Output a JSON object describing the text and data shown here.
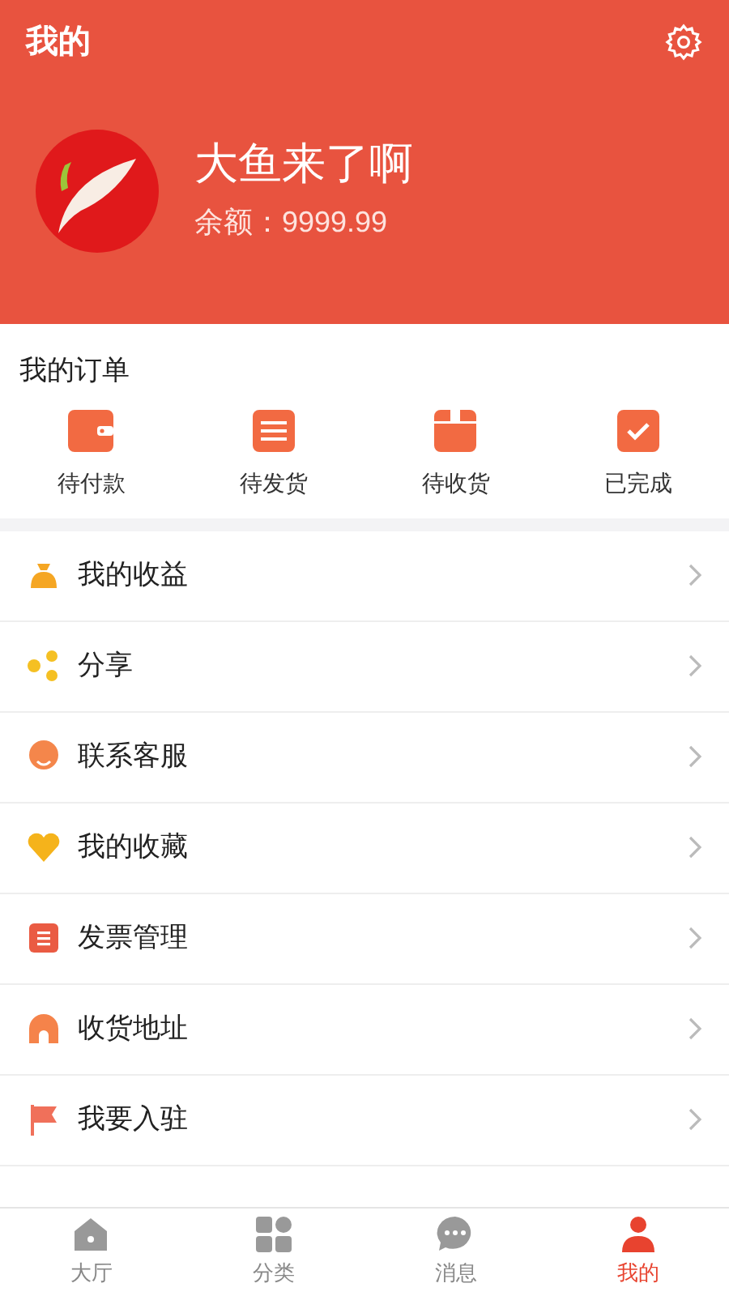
{
  "header": {
    "title": "我的",
    "username": "大鱼来了啊",
    "balance": "余额：9999.99"
  },
  "orders": {
    "title": "我的订单",
    "items": [
      {
        "kind": "wallet",
        "label": "待付款"
      },
      {
        "kind": "list",
        "label": "待发货"
      },
      {
        "kind": "box",
        "label": "待收货"
      },
      {
        "kind": "done",
        "label": "已完成"
      }
    ]
  },
  "menu": [
    {
      "kind": "money",
      "label": "我的收益"
    },
    {
      "kind": "share",
      "label": "分享"
    },
    {
      "kind": "service",
      "label": "联系客服"
    },
    {
      "kind": "heart",
      "label": "我的收藏"
    },
    {
      "kind": "invoice",
      "label": "发票管理"
    },
    {
      "kind": "address",
      "label": "收货地址"
    },
    {
      "kind": "flag",
      "label": "我要入驻"
    }
  ],
  "tabs": [
    {
      "kind": "home",
      "label": "大厅",
      "selected": false
    },
    {
      "kind": "grid",
      "label": "分类",
      "selected": false
    },
    {
      "kind": "chat",
      "label": "消息",
      "selected": false
    },
    {
      "kind": "user",
      "label": "我的",
      "selected": true
    }
  ]
}
